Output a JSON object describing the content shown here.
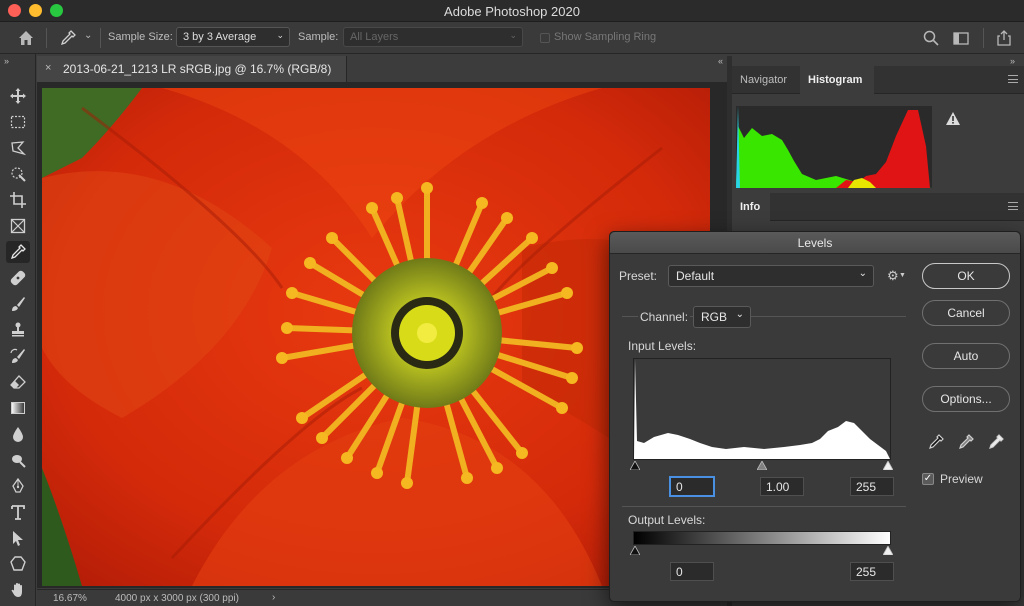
{
  "app": {
    "title": "Adobe Photoshop 2020"
  },
  "options_bar": {
    "sample_size_label": "Sample Size:",
    "sample_size_value": "3 by 3 Average",
    "sample_label": "Sample:",
    "sample_value": "All Layers",
    "show_sampling_ring_label": "Show Sampling Ring"
  },
  "toolbar": {
    "tools": [
      "move-tool",
      "marquee-tool",
      "lasso-tool",
      "quick-selection-tool",
      "crop-tool",
      "frame-tool",
      "eyedropper-tool",
      "healing-brush-tool",
      "brush-tool",
      "clone-stamp-tool",
      "history-brush-tool",
      "eraser-tool",
      "gradient-tool",
      "blur-tool",
      "dodge-tool",
      "pen-tool",
      "type-tool",
      "path-selection-tool",
      "shape-tool",
      "hand-tool"
    ],
    "active_tool": "eyedropper-tool"
  },
  "document": {
    "tab_close": "×",
    "tab_title": "2013-06-21_1213 LR sRGB.jpg @ 16.7% (RGB/8)"
  },
  "status": {
    "zoom": "16.67%",
    "doc_info": "4000 px x 3000 px (300 ppi)",
    "arrow": "›"
  },
  "panels": {
    "top_tabs": [
      "Navigator",
      "Histogram"
    ],
    "top_active": "Histogram",
    "bottom_tabs": [
      "Info"
    ],
    "bottom_active": "Info"
  },
  "levels": {
    "title": "Levels",
    "preset_label": "Preset:",
    "preset_value": "Default",
    "channel_label": "Channel:",
    "channel_value": "RGB",
    "input_levels_label": "Input Levels:",
    "input_black": "0",
    "input_gamma": "1.00",
    "input_white": "255",
    "output_levels_label": "Output Levels:",
    "output_black": "0",
    "output_white": "255",
    "buttons": {
      "ok": "OK",
      "cancel": "Cancel",
      "auto": "Auto",
      "options": "Options..."
    },
    "preview_label": "Preview",
    "preview_checked": true
  },
  "colors": {
    "accent_focus": "#4a90e2",
    "histogram_green": "#39e600",
    "histogram_red": "#e01414",
    "histogram_yellow": "#e6e600",
    "histogram_cyan": "#2ad4e6"
  }
}
